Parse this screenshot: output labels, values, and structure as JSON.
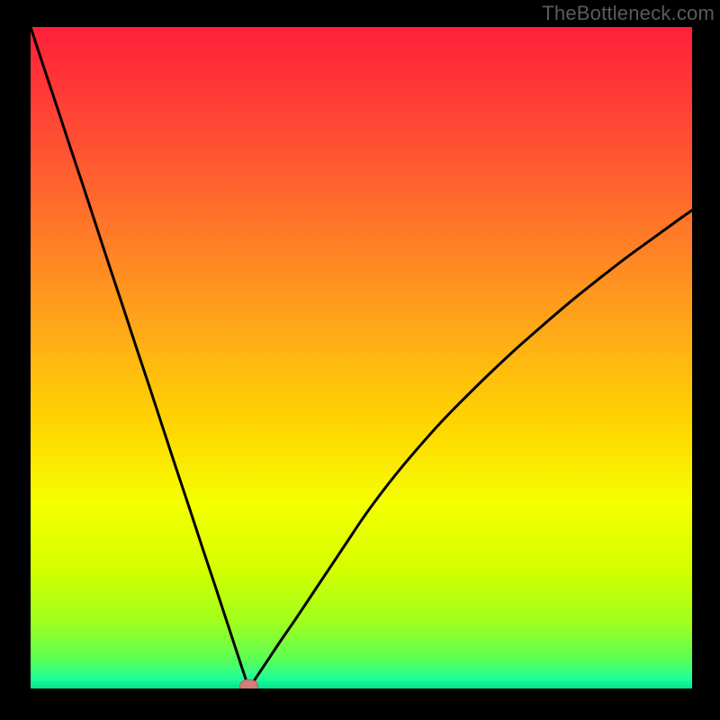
{
  "watermark": "TheBottleneck.com",
  "colors": {
    "frame": "#000000",
    "curve": "#000000",
    "marker_fill": "#cf7f7a",
    "marker_stroke": "#b65e57",
    "gradient_stops": [
      {
        "offset": 0.0,
        "color": "#ff1f3a"
      },
      {
        "offset": 0.1,
        "color": "#ff3a36"
      },
      {
        "offset": 0.22,
        "color": "#ff5d30"
      },
      {
        "offset": 0.35,
        "color": "#ff8624"
      },
      {
        "offset": 0.48,
        "color": "#ffb015"
      },
      {
        "offset": 0.6,
        "color": "#ffd500"
      },
      {
        "offset": 0.72,
        "color": "#f5ff00"
      },
      {
        "offset": 0.82,
        "color": "#d4ff00"
      },
      {
        "offset": 0.9,
        "color": "#9fff1e"
      },
      {
        "offset": 0.955,
        "color": "#5cff55"
      },
      {
        "offset": 0.985,
        "color": "#1fff9a"
      },
      {
        "offset": 1.0,
        "color": "#00e48a"
      }
    ]
  },
  "chart_data": {
    "type": "line",
    "title": "",
    "xlabel": "",
    "ylabel": "",
    "xlim": [
      0,
      100
    ],
    "ylim": [
      0,
      100
    ],
    "x": [
      0,
      2,
      4,
      6,
      8,
      10,
      12,
      14,
      16,
      18,
      20,
      22,
      24,
      26,
      28,
      30,
      32,
      33,
      34,
      36,
      38,
      40,
      42,
      44,
      46,
      48,
      50,
      52,
      55,
      58,
      62,
      66,
      70,
      74,
      78,
      82,
      86,
      90,
      94,
      98,
      100
    ],
    "values": [
      100.0,
      93.9,
      87.9,
      81.8,
      75.8,
      69.7,
      63.6,
      57.6,
      51.5,
      45.5,
      39.4,
      33.3,
      27.3,
      21.2,
      15.2,
      9.1,
      3.0,
      0.0,
      1.5,
      4.5,
      7.5,
      10.4,
      13.4,
      16.4,
      19.4,
      22.4,
      25.4,
      28.2,
      32.1,
      35.7,
      40.2,
      44.3,
      48.2,
      51.9,
      55.4,
      58.8,
      62.0,
      65.1,
      68.0,
      70.9,
      72.3
    ],
    "marker": {
      "x": 33,
      "y": 0
    }
  }
}
